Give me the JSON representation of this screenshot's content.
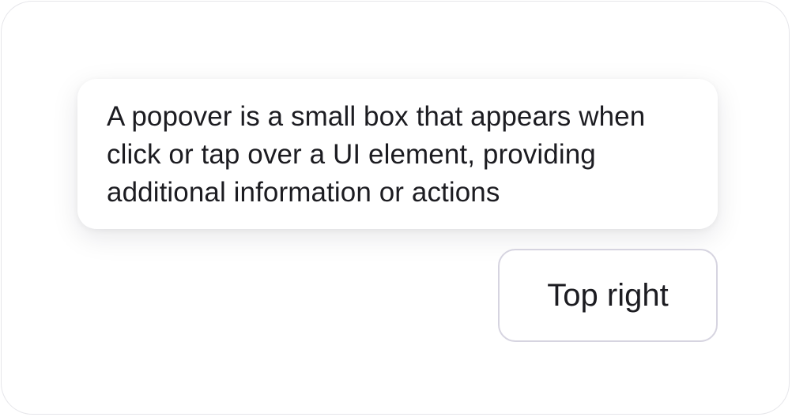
{
  "popover": {
    "text": "A popover is a small box that appears when click or tap over a UI element, providing additional information or actions"
  },
  "trigger": {
    "label": "Top right"
  },
  "colors": {
    "text": "#1c1c21",
    "button_border": "#d6d4e0",
    "frame_border": "#e6e6ea",
    "background": "#ffffff"
  }
}
